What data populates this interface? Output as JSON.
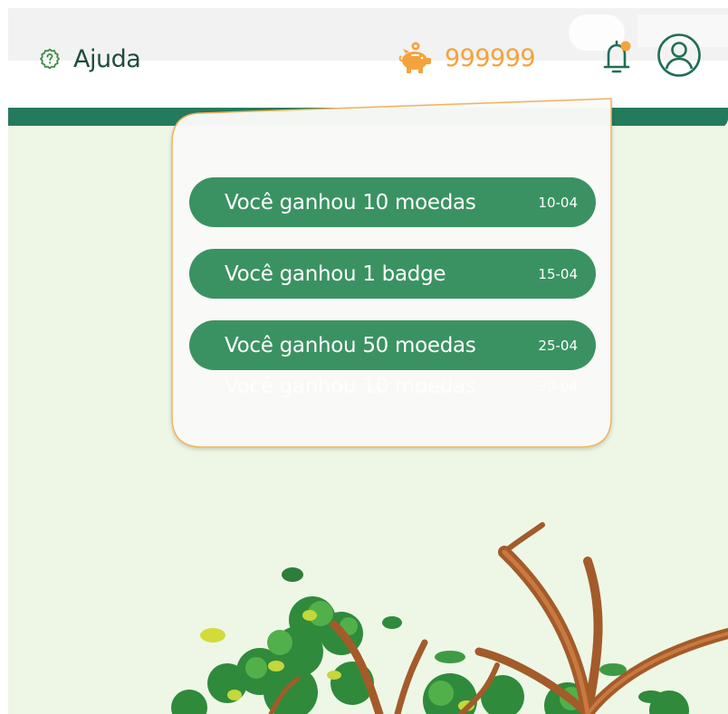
{
  "header": {
    "help_label": "Ajuda",
    "coins": "999999"
  },
  "notifications": [
    {
      "text": "Você ganhou 10 moedas",
      "date": "10-04"
    },
    {
      "text": "Você ganhou 1 badge",
      "date": "15-04"
    },
    {
      "text": "Você ganhou 50 moedas",
      "date": "25-04"
    },
    {
      "text": "Você ganhou 10 moedas",
      "date": "30-04"
    }
  ],
  "colors": {
    "primary_green": "#247a5c",
    "notification_green": "#3a9262",
    "coin_orange": "#f4a33b",
    "background": "#eef7e6",
    "popover_border": "#f2b25a"
  },
  "icons": [
    "help-icon",
    "piggy-bank-icon",
    "bell-icon",
    "profile-icon"
  ]
}
